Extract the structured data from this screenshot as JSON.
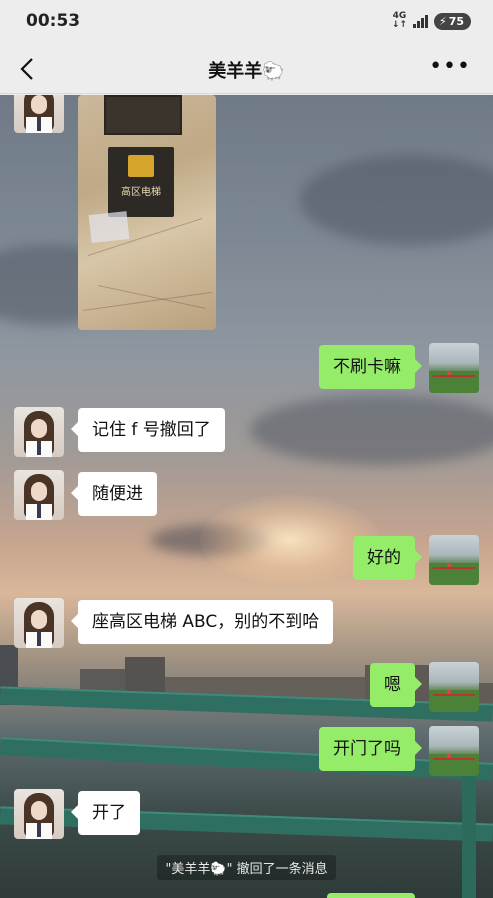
{
  "status_bar": {
    "time": "00:53",
    "network": "4G",
    "battery": "75"
  },
  "header": {
    "title": "美羊羊🐑"
  },
  "image_message": {
    "sign_text": "高区电梯"
  },
  "messages": [
    {
      "from": "me",
      "text": "不刷卡嘛"
    },
    {
      "from": "her",
      "text": "记住 f 号撤回了"
    },
    {
      "from": "her",
      "text": "随便进"
    },
    {
      "from": "me",
      "text": "好的"
    },
    {
      "from": "her",
      "text": "座高区电梯 ABC，别的不到哈"
    },
    {
      "from": "me",
      "text": "嗯"
    },
    {
      "from": "me",
      "text": "开门了吗"
    },
    {
      "from": "her",
      "text": "开了"
    }
  ],
  "recall_notice": "\"美羊羊🐑\" 撤回了一条消息",
  "colors": {
    "my_bubble": "#95ec69",
    "her_bubble": "#ffffff",
    "header_bg": "#ededed"
  }
}
